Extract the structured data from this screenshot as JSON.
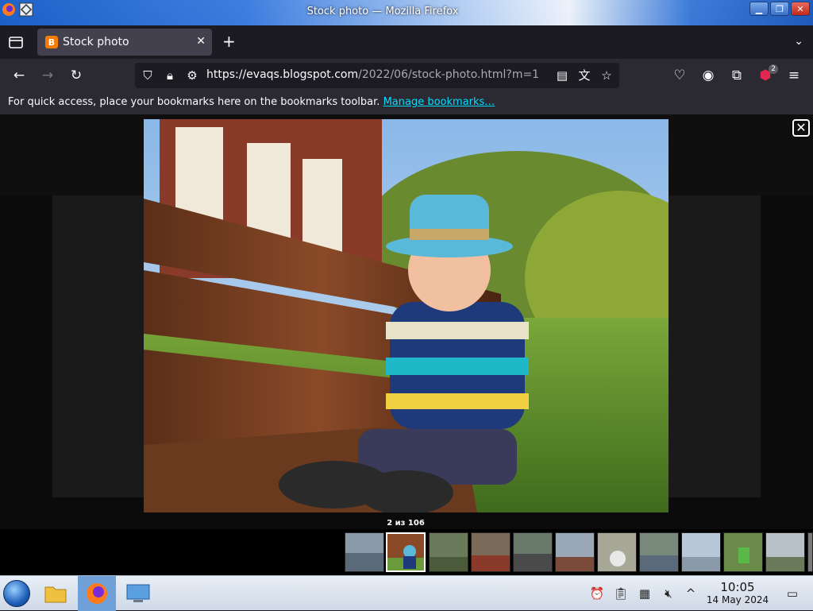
{
  "window": {
    "title": "Stock photo — Mozilla Firefox"
  },
  "tabs": [
    {
      "label": "Stock photo",
      "favicon": "B"
    }
  ],
  "navbar": {
    "url_host": "https://evaqs.blogspot.com",
    "url_path": "/2022/06/stock-photo.html?m=1",
    "extensions_badge": "2"
  },
  "bookmarks": {
    "message": "For quick access, place your bookmarks here on the bookmarks toolbar.",
    "link": "Manage bookmarks…"
  },
  "lightbox": {
    "close_label": "✕",
    "counter": "2 из 106",
    "thumb_count": 12,
    "active_thumb": 1
  },
  "taskbar": {
    "time": "10:05",
    "date": "14 May 2024"
  },
  "colors": {
    "accent_link": "#00ddff",
    "tab_active": "#42414d",
    "toolbar": "#2b2a33"
  }
}
